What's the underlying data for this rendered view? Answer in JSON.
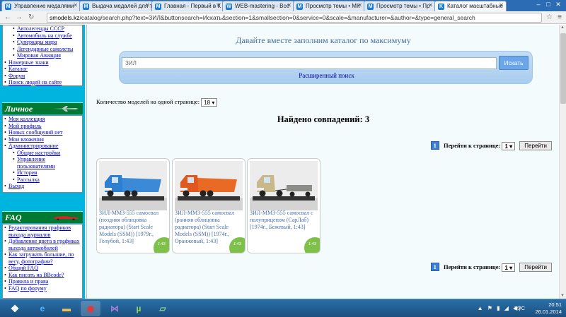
{
  "browser": {
    "tabs": [
      {
        "label": "Управление медалями"
      },
      {
        "label": "Выдача медалей для т"
      },
      {
        "label": "Главная - Первый в К"
      },
      {
        "label": "WEB-mastering - Все"
      },
      {
        "label": "Просмотр темы • МК"
      },
      {
        "label": "Просмотр темы • Пр"
      },
      {
        "label": "Каталог масштабные"
      }
    ],
    "url_host": "smodels.kz",
    "url_path": "/catalog/search.php?text=ЗИЛ&buttonsearch=Искать&section=1&smallsection=0&service=0&scale=&manufacturer=&author=&type=general_search"
  },
  "sidebar": {
    "top_items": [
      {
        "label": "Автолегенды СССР",
        "sub": true
      },
      {
        "label": "Автомобиль на службе",
        "sub": true
      },
      {
        "label": "Суперкары мира",
        "sub": true
      },
      {
        "label": "Легендарные самолеты",
        "sub": true
      },
      {
        "label": "Мировая Авиация",
        "sub": true
      },
      {
        "label": "Номерные знаки",
        "sub": false
      },
      {
        "label": "Каталог",
        "sub": false
      },
      {
        "label": "Форум",
        "sub": false
      },
      {
        "label": "Поиск людей на сайте",
        "sub": false
      }
    ],
    "personal_title": "Личное",
    "personal_items": [
      {
        "label": "Моя коллекция",
        "sub": false
      },
      {
        "label": "Мой профиль",
        "sub": false
      },
      {
        "label": "Новых сообщений нет",
        "sub": false
      },
      {
        "label": "Мои вложения",
        "sub": false
      },
      {
        "label": "Администрирование",
        "sub": false
      },
      {
        "label": "Общие настройки",
        "sub": true
      },
      {
        "label": "Управление пользователями",
        "sub": true
      },
      {
        "label": "История",
        "sub": true
      },
      {
        "label": "Рассылка",
        "sub": true
      },
      {
        "label": "Выход",
        "sub": false
      }
    ],
    "faq_title": "FAQ",
    "faq_items": [
      {
        "label": "Редактирования графиков выхода журналов"
      },
      {
        "label": "Добавление цвета в графиках выхода автомобилей"
      },
      {
        "label": "Как загружать большие, по весу, фотографии?"
      },
      {
        "label": "Общий FAQ"
      },
      {
        "label": "Как писать на BBcode?"
      },
      {
        "label": "Правила и права"
      },
      {
        "label": "FAQ по форуму"
      }
    ]
  },
  "main": {
    "slogan": "Давайте вместе заполним каталог по максимуму",
    "search_value": "ЗИЛ",
    "search_button": "Искать",
    "advanced_search": "Расширенный поиск",
    "per_page_label": "Количество моделей на одной странице:",
    "per_page_value": "18",
    "found_text": "Найдено совпадений: 3",
    "pager": {
      "current": "1",
      "goto_label": "Перейти к странице:",
      "select_value": "1",
      "go_button": "Перейти"
    },
    "results": [
      {
        "desc": "ЗИЛ-ММЗ-555 самосвал (поздняя облицовка радиатора) (Start Scale Models (SSM)) [1979г., Голубой, 1:43]",
        "scale": "1:43",
        "body_color": "#2f7fd0",
        "bed_color": "#3a8ad8"
      },
      {
        "desc": "ЗИЛ-ММЗ-555 самосвал (ранняя облицовка радиатора) (Start Scale Models (SSM)) [1974г., Оранжевый, 1:43]",
        "scale": "1:43",
        "body_color": "#e0581e",
        "bed_color": "#e86a25"
      },
      {
        "desc": "ЗИЛ-ММЗ-555 самосвал с полуприцепом (СарЛаб) [1974г., Бежевый, 1:43]",
        "scale": "1:43",
        "body_color": "#c9b98a",
        "bed_color": "#8c8c88"
      }
    ]
  },
  "taskbar": {
    "lang": "РУС",
    "time": "20:51",
    "date": "26.01.2014"
  }
}
